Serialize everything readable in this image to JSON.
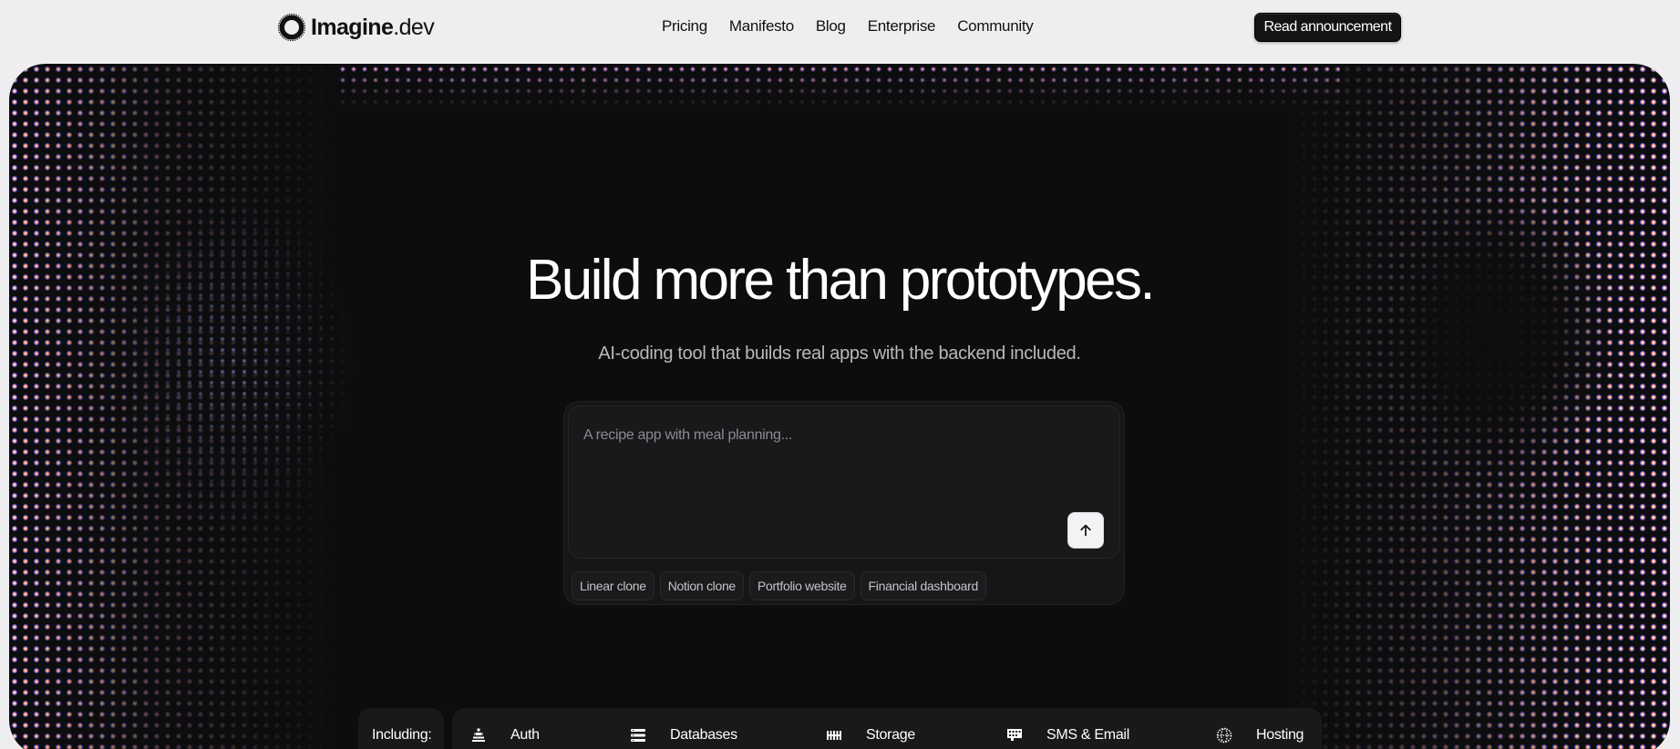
{
  "brand": {
    "bold": "Imagine",
    "suffix": ".dev",
    "icon": "sunburst-logo-icon"
  },
  "nav": {
    "links": [
      "Pricing",
      "Manifesto",
      "Blog",
      "Enterprise",
      "Community"
    ],
    "cta": "Read announcement"
  },
  "hero": {
    "title": "Build more than prototypes.",
    "subtitle": "AI-coding tool that builds real apps with the backend included."
  },
  "prompt": {
    "placeholder": "A recipe app with meal planning...",
    "value": "",
    "send_icon": "arrow-up-icon",
    "suggestions": [
      "Linear clone",
      "Notion clone",
      "Portfolio website",
      "Financial dashboard"
    ]
  },
  "features": {
    "label": "Including:",
    "items": [
      {
        "label": "Auth",
        "icon": "person-icon"
      },
      {
        "label": "Databases",
        "icon": "database-icon"
      },
      {
        "label": "Storage",
        "icon": "storage-icon"
      },
      {
        "label": "SMS & Email",
        "icon": "message-icon"
      },
      {
        "label": "Hosting",
        "icon": "globe-icon"
      }
    ]
  },
  "colors": {
    "page_bg": "#eeeef0",
    "hero_bg": "#0d0d0e",
    "cta_bg": "#141414",
    "dot_orange": "#ff5a2e",
    "dot_blue": "#2f52ff"
  }
}
